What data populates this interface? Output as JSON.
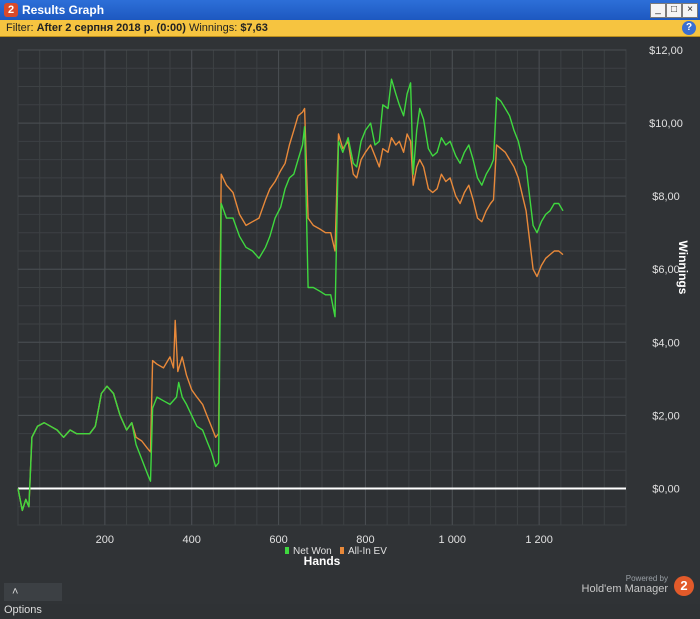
{
  "window": {
    "title": "Results Graph",
    "app_icon_text": "2",
    "buttons": {
      "minimize": "_",
      "maximize": "□",
      "close": "×"
    }
  },
  "filter": {
    "prefix": "Filter:",
    "value": "After 2 серпня 2018 р. (0:00)",
    "winnings_label": "Winnings:",
    "winnings_value": "$7,63"
  },
  "options_label": "Options",
  "branding": {
    "powered": "Powered by",
    "name": "Hold'em Manager",
    "logo_text": "2"
  },
  "colors": {
    "background": "#303336",
    "grid": "#3d4144",
    "net_won": "#3fd83f",
    "all_in_ev": "#e8893a",
    "zero_line": "#ffffff"
  },
  "chart_data": {
    "type": "line",
    "xlabel": "Hands",
    "ylabel": "Winnings",
    "xlim": [
      0,
      1400
    ],
    "ylim": [
      -1,
      12
    ],
    "x_ticks": [
      200,
      400,
      600,
      800,
      1000,
      1200
    ],
    "x_tick_labels": [
      "200",
      "400",
      "600",
      "800",
      "1 000",
      "1 200"
    ],
    "y_ticks": [
      0,
      2,
      4,
      6,
      8,
      10,
      12
    ],
    "y_tick_labels": [
      "$0,00",
      "$2,00",
      "$4,00",
      "$6,00",
      "$8,00",
      "$10,00",
      "$12,00"
    ],
    "grid": true,
    "legend_position": "bottom-center",
    "series": [
      {
        "name": "Net Won",
        "color": "#3fd83f",
        "points": [
          [
            0,
            0
          ],
          [
            10,
            -0.6
          ],
          [
            18,
            -0.3
          ],
          [
            25,
            -0.5
          ],
          [
            32,
            1.4
          ],
          [
            45,
            1.7
          ],
          [
            60,
            1.8
          ],
          [
            75,
            1.7
          ],
          [
            90,
            1.6
          ],
          [
            105,
            1.4
          ],
          [
            120,
            1.6
          ],
          [
            135,
            1.5
          ],
          [
            150,
            1.5
          ],
          [
            165,
            1.5
          ],
          [
            178,
            1.7
          ],
          [
            192,
            2.6
          ],
          [
            205,
            2.8
          ],
          [
            220,
            2.6
          ],
          [
            235,
            2.0
          ],
          [
            250,
            1.6
          ],
          [
            262,
            1.8
          ],
          [
            272,
            1.2
          ],
          [
            285,
            0.8
          ],
          [
            298,
            0.4
          ],
          [
            305,
            0.2
          ],
          [
            310,
            2.2
          ],
          [
            320,
            2.5
          ],
          [
            335,
            2.4
          ],
          [
            350,
            2.3
          ],
          [
            365,
            2.5
          ],
          [
            370,
            2.9
          ],
          [
            378,
            2.5
          ],
          [
            388,
            2.3
          ],
          [
            400,
            2.0
          ],
          [
            412,
            1.7
          ],
          [
            425,
            1.6
          ],
          [
            435,
            1.3
          ],
          [
            445,
            1.0
          ],
          [
            455,
            0.6
          ],
          [
            462,
            0.7
          ],
          [
            468,
            7.8
          ],
          [
            480,
            7.4
          ],
          [
            495,
            7.4
          ],
          [
            510,
            6.9
          ],
          [
            525,
            6.6
          ],
          [
            540,
            6.5
          ],
          [
            555,
            6.3
          ],
          [
            570,
            6.6
          ],
          [
            580,
            6.9
          ],
          [
            592,
            7.4
          ],
          [
            605,
            7.7
          ],
          [
            615,
            8.2
          ],
          [
            625,
            8.5
          ],
          [
            635,
            8.6
          ],
          [
            645,
            9.0
          ],
          [
            655,
            9.4
          ],
          [
            660,
            9.9
          ],
          [
            668,
            5.5
          ],
          [
            680,
            5.5
          ],
          [
            695,
            5.4
          ],
          [
            708,
            5.3
          ],
          [
            720,
            5.3
          ],
          [
            730,
            4.7
          ],
          [
            738,
            9.5
          ],
          [
            748,
            9.2
          ],
          [
            760,
            9.6
          ],
          [
            772,
            8.9
          ],
          [
            780,
            8.8
          ],
          [
            790,
            9.5
          ],
          [
            800,
            9.8
          ],
          [
            812,
            10.0
          ],
          [
            822,
            9.4
          ],
          [
            832,
            9.5
          ],
          [
            840,
            10.5
          ],
          [
            852,
            10.4
          ],
          [
            860,
            11.2
          ],
          [
            870,
            10.8
          ],
          [
            878,
            10.5
          ],
          [
            888,
            10.2
          ],
          [
            896,
            10.8
          ],
          [
            904,
            11.1
          ],
          [
            910,
            8.6
          ],
          [
            918,
            9.8
          ],
          [
            925,
            10.4
          ],
          [
            934,
            10.1
          ],
          [
            945,
            9.3
          ],
          [
            955,
            9.1
          ],
          [
            965,
            9.2
          ],
          [
            975,
            9.6
          ],
          [
            985,
            9.4
          ],
          [
            995,
            9.5
          ],
          [
            1008,
            9.1
          ],
          [
            1018,
            8.9
          ],
          [
            1028,
            9.2
          ],
          [
            1038,
            9.4
          ],
          [
            1048,
            9.0
          ],
          [
            1058,
            8.5
          ],
          [
            1068,
            8.3
          ],
          [
            1078,
            8.6
          ],
          [
            1088,
            8.8
          ],
          [
            1095,
            9.0
          ],
          [
            1102,
            10.7
          ],
          [
            1112,
            10.6
          ],
          [
            1122,
            10.4
          ],
          [
            1132,
            10.2
          ],
          [
            1142,
            9.8
          ],
          [
            1152,
            9.5
          ],
          [
            1162,
            9.0
          ],
          [
            1170,
            8.8
          ],
          [
            1178,
            8.0
          ],
          [
            1186,
            7.2
          ],
          [
            1195,
            7.0
          ],
          [
            1205,
            7.3
          ],
          [
            1215,
            7.5
          ],
          [
            1225,
            7.6
          ],
          [
            1235,
            7.8
          ],
          [
            1245,
            7.8
          ],
          [
            1255,
            7.6
          ]
        ]
      },
      {
        "name": "All-In EV",
        "color": "#e8893a",
        "points": [
          [
            0,
            0
          ],
          [
            10,
            -0.6
          ],
          [
            18,
            -0.3
          ],
          [
            25,
            -0.5
          ],
          [
            32,
            1.4
          ],
          [
            45,
            1.7
          ],
          [
            60,
            1.8
          ],
          [
            75,
            1.7
          ],
          [
            90,
            1.6
          ],
          [
            105,
            1.4
          ],
          [
            120,
            1.6
          ],
          [
            135,
            1.5
          ],
          [
            150,
            1.5
          ],
          [
            165,
            1.5
          ],
          [
            178,
            1.7
          ],
          [
            192,
            2.6
          ],
          [
            205,
            2.8
          ],
          [
            220,
            2.6
          ],
          [
            235,
            2.0
          ],
          [
            250,
            1.6
          ],
          [
            262,
            1.8
          ],
          [
            272,
            1.4
          ],
          [
            285,
            1.3
          ],
          [
            298,
            1.1
          ],
          [
            305,
            1.0
          ],
          [
            310,
            3.5
          ],
          [
            320,
            3.4
          ],
          [
            335,
            3.3
          ],
          [
            350,
            3.6
          ],
          [
            358,
            3.3
          ],
          [
            362,
            4.6
          ],
          [
            368,
            3.2
          ],
          [
            378,
            3.6
          ],
          [
            388,
            3.1
          ],
          [
            400,
            2.7
          ],
          [
            412,
            2.5
          ],
          [
            425,
            2.3
          ],
          [
            435,
            2.0
          ],
          [
            445,
            1.7
          ],
          [
            455,
            1.4
          ],
          [
            462,
            1.5
          ],
          [
            468,
            8.6
          ],
          [
            480,
            8.3
          ],
          [
            495,
            8.1
          ],
          [
            510,
            7.5
          ],
          [
            525,
            7.2
          ],
          [
            540,
            7.3
          ],
          [
            555,
            7.4
          ],
          [
            570,
            7.9
          ],
          [
            580,
            8.2
          ],
          [
            592,
            8.4
          ],
          [
            605,
            8.7
          ],
          [
            615,
            8.9
          ],
          [
            625,
            9.4
          ],
          [
            635,
            9.8
          ],
          [
            645,
            10.2
          ],
          [
            655,
            10.3
          ],
          [
            660,
            10.4
          ],
          [
            668,
            7.4
          ],
          [
            680,
            7.2
          ],
          [
            695,
            7.1
          ],
          [
            708,
            7.0
          ],
          [
            720,
            7.0
          ],
          [
            730,
            6.5
          ],
          [
            738,
            9.7
          ],
          [
            748,
            9.3
          ],
          [
            760,
            9.5
          ],
          [
            772,
            8.6
          ],
          [
            780,
            8.5
          ],
          [
            790,
            9.0
          ],
          [
            800,
            9.2
          ],
          [
            812,
            9.4
          ],
          [
            822,
            9.1
          ],
          [
            832,
            8.8
          ],
          [
            840,
            9.3
          ],
          [
            852,
            9.2
          ],
          [
            860,
            9.6
          ],
          [
            870,
            9.4
          ],
          [
            878,
            9.5
          ],
          [
            888,
            9.2
          ],
          [
            896,
            9.7
          ],
          [
            904,
            9.5
          ],
          [
            910,
            8.3
          ],
          [
            918,
            8.8
          ],
          [
            925,
            9.0
          ],
          [
            934,
            8.8
          ],
          [
            945,
            8.2
          ],
          [
            955,
            8.1
          ],
          [
            965,
            8.2
          ],
          [
            975,
            8.6
          ],
          [
            985,
            8.4
          ],
          [
            995,
            8.5
          ],
          [
            1008,
            8.0
          ],
          [
            1018,
            7.8
          ],
          [
            1028,
            8.1
          ],
          [
            1038,
            8.3
          ],
          [
            1048,
            7.9
          ],
          [
            1058,
            7.4
          ],
          [
            1068,
            7.3
          ],
          [
            1078,
            7.6
          ],
          [
            1088,
            7.8
          ],
          [
            1095,
            7.9
          ],
          [
            1102,
            9.4
          ],
          [
            1112,
            9.3
          ],
          [
            1122,
            9.2
          ],
          [
            1132,
            9.0
          ],
          [
            1142,
            8.8
          ],
          [
            1152,
            8.5
          ],
          [
            1162,
            8.0
          ],
          [
            1170,
            7.6
          ],
          [
            1178,
            6.8
          ],
          [
            1186,
            6.0
          ],
          [
            1195,
            5.8
          ],
          [
            1205,
            6.1
          ],
          [
            1215,
            6.3
          ],
          [
            1225,
            6.4
          ],
          [
            1235,
            6.5
          ],
          [
            1245,
            6.5
          ],
          [
            1255,
            6.4
          ]
        ]
      }
    ]
  }
}
